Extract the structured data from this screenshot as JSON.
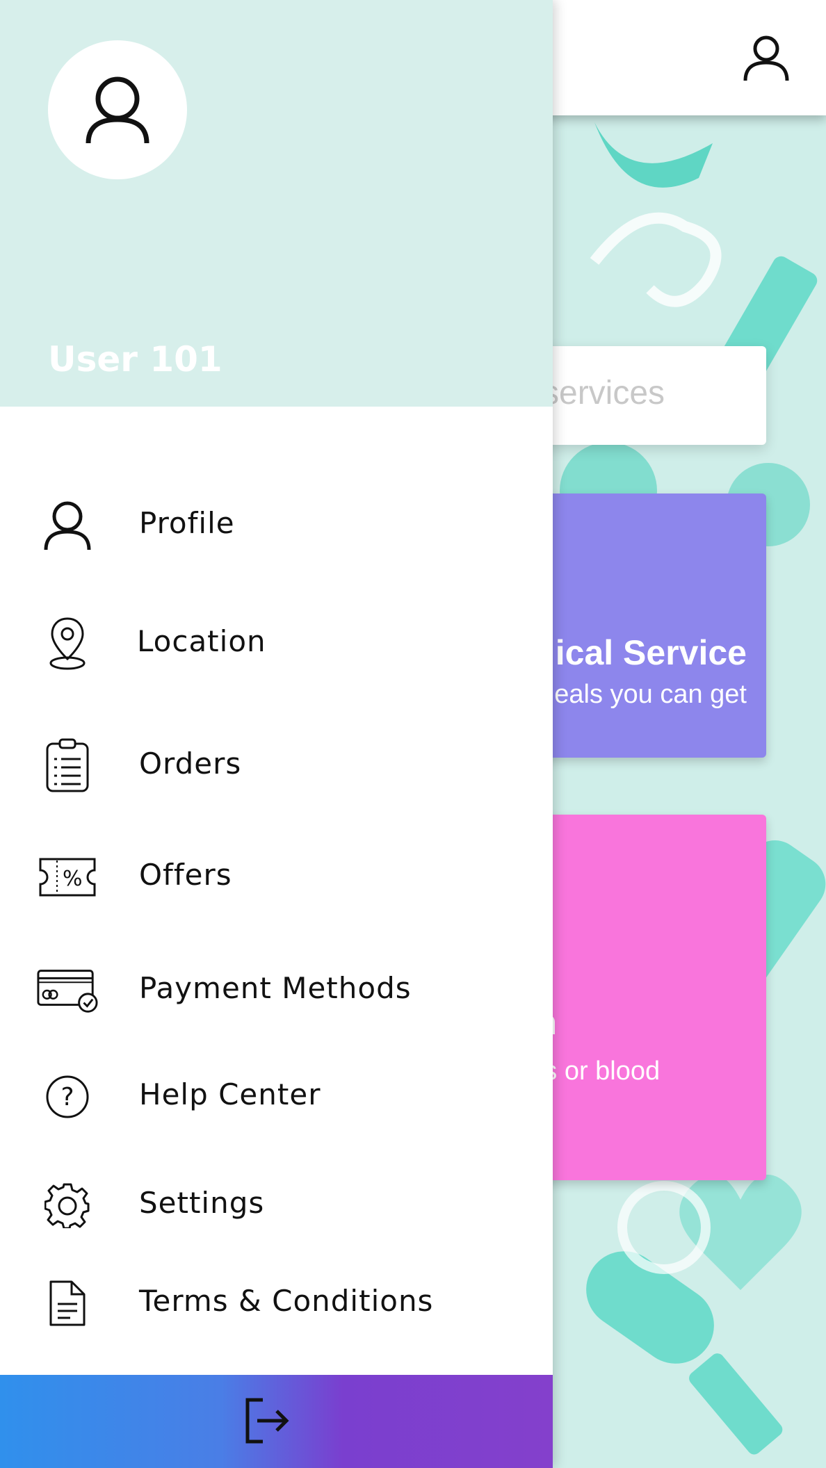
{
  "header": {
    "profile_icon": "user-icon"
  },
  "search": {
    "placeholder": "services"
  },
  "cards": [
    {
      "title": "ical Service",
      "subtitle": "eals you can get",
      "color": "#8d86ec"
    },
    {
      "title": "on",
      "subtitle": "nds or blood",
      "color": "#f975dc"
    }
  ],
  "drawer": {
    "user_name": "User 101",
    "header_color": "#d7efeb",
    "menu": [
      {
        "label": "Profile",
        "icon": "user-icon"
      },
      {
        "label": "Location",
        "icon": "location-pin-icon"
      },
      {
        "label": "Orders",
        "icon": "clipboard-icon"
      },
      {
        "label": "Offers",
        "icon": "coupon-percent-icon"
      },
      {
        "label": "Payment Methods",
        "icon": "credit-card-check-icon"
      },
      {
        "label": "Help Center",
        "icon": "question-circle-icon"
      },
      {
        "label": "Settings",
        "icon": "gear-icon"
      },
      {
        "label": "Terms & Conditions",
        "icon": "document-icon"
      }
    ],
    "logout_icon": "logout-icon",
    "logout_gradient": [
      "#3090ec",
      "#8440cc"
    ]
  }
}
